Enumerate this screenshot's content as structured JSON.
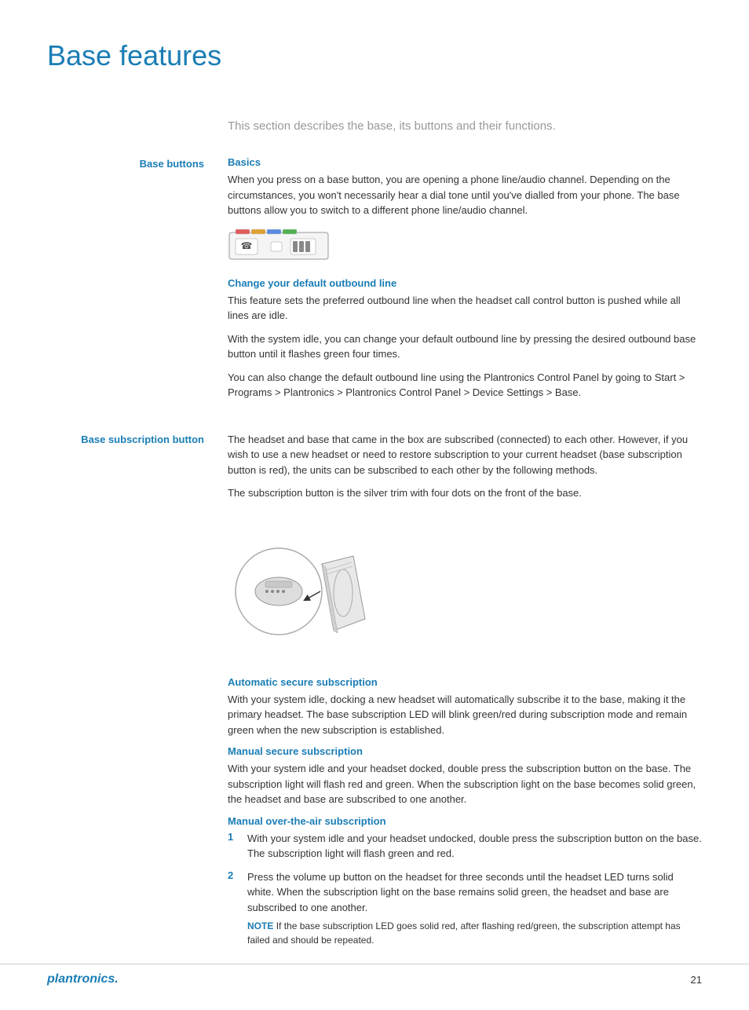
{
  "page": {
    "title": "Base features",
    "intro": "This section describes the base, its buttons and their functions.",
    "page_number": "21",
    "footer_logo": "plantronics."
  },
  "sections": [
    {
      "id": "base-buttons",
      "label": "Base buttons",
      "subsections": [
        {
          "title": "Basics",
          "paragraphs": [
            "When you press on a base button, you are opening a phone line/audio channel. Depending on the circumstances, you won't necessarily hear a dial tone until you've dialled from your phone. The base buttons allow you to switch to a different phone line/audio channel."
          ],
          "has_base_image": true
        },
        {
          "title": "Change your default outbound line",
          "paragraphs": [
            "This feature sets the preferred outbound line when the headset call control button is pushed while all lines are idle.",
            "With the system idle, you can change your default outbound line by pressing the desired outbound base button until it flashes green four times.",
            "You can also change the default outbound line using the Plantronics Control Panel by going to Start > Programs > Plantronics > Plantronics Control Panel > Device Settings > Base."
          ]
        }
      ]
    },
    {
      "id": "base-subscription-button",
      "label": "Base subscription button",
      "subsections": [
        {
          "title": "",
          "paragraphs": [
            "The headset and base that came in the box are subscribed (connected) to each other. However, if you wish to use a new headset or need to restore subscription to your current headset (base subscription button is red), the units can be subscribed to each other by the following methods.",
            "The subscription button is the silver trim with four dots on the front of the base."
          ],
          "has_device_image": true
        },
        {
          "title": "Automatic secure subscription",
          "paragraphs": [
            "With your system idle, docking a new headset will automatically subscribe it to the base, making it the primary headset. The base subscription LED will blink green/red during subscription mode and remain green when the new subscription is established."
          ]
        },
        {
          "title": "Manual secure subscription",
          "paragraphs": [
            "With your system idle and your headset docked, double press the subscription button on the base. The subscription light will flash red and green. When the subscription light on the base becomes solid green, the headset and base are subscribed to one another."
          ]
        },
        {
          "title": "Manual over-the-air subscription",
          "numbered_items": [
            "With your system idle and your headset undocked, double press the subscription button on the base. The subscription light will flash green and red.",
            "Press the volume up button on the headset for three seconds until the headset LED turns solid white. When the subscription light on the base remains solid green, the headset and base are subscribed to one another."
          ],
          "note": "If the base subscription LED goes solid red, after flashing red/green, the subscription attempt has failed and should be repeated."
        }
      ]
    }
  ]
}
